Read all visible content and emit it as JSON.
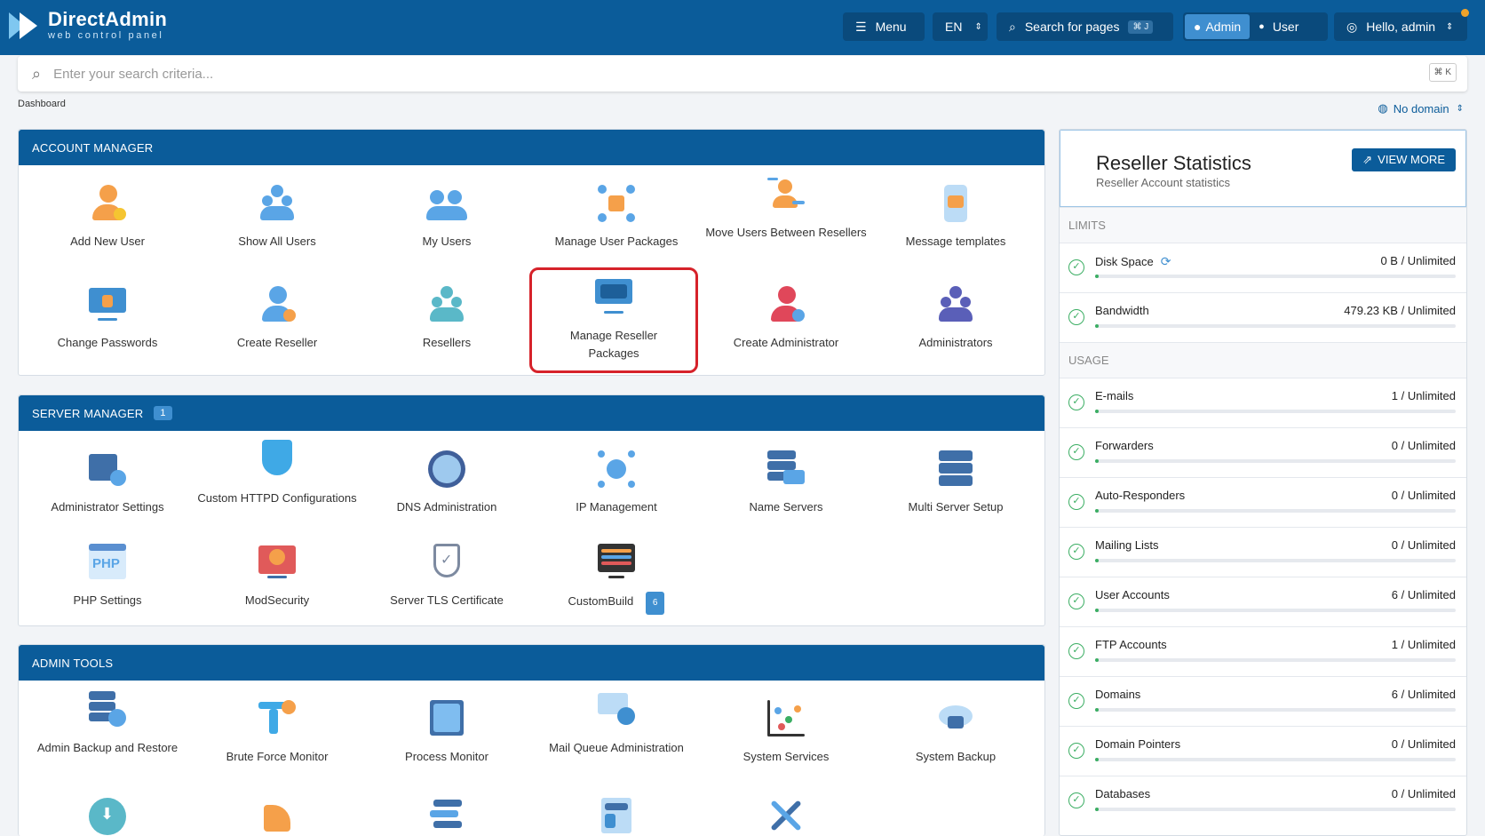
{
  "header": {
    "logo_title": "DirectAdmin",
    "logo_sub": "web control panel",
    "menu_label": "Menu",
    "lang": "EN",
    "search_pages": "Search for pages",
    "search_pages_kbd": "⌘ J",
    "role_admin": "Admin",
    "role_user": "User",
    "hello": "Hello, admin"
  },
  "search": {
    "placeholder": "Enter your search criteria...",
    "kbd": "⌘ K"
  },
  "breadcrumb": "Dashboard",
  "domain_selector": "No domain",
  "account_manager": {
    "title": "ACCOUNT MANAGER",
    "items": [
      "Add New User",
      "Show All Users",
      "My Users",
      "Manage User Packages",
      "Move Users Between Resellers",
      "Message templates",
      "Change Passwords",
      "Create Reseller",
      "Resellers",
      "Manage Reseller Packages",
      "Create Administrator",
      "Administrators"
    ]
  },
  "server_manager": {
    "title": "SERVER MANAGER",
    "badge": "1",
    "items": [
      "Administrator Settings",
      "Custom HTTPD Configurations",
      "DNS Administration",
      "IP Management",
      "Name Servers",
      "Multi Server Setup",
      "PHP Settings",
      "ModSecurity",
      "Server TLS Certificate",
      "CustomBuild"
    ],
    "custombuild_badge": "6"
  },
  "admin_tools": {
    "title": "ADMIN TOOLS",
    "items": [
      "Admin Backup and Restore",
      "Brute Force Monitor",
      "Process Monitor",
      "Mail Queue Administration",
      "System Services",
      "System Backup"
    ]
  },
  "stats": {
    "title": "Reseller Statistics",
    "subtitle": "Reseller Account statistics",
    "view_more": "VIEW MORE",
    "limits_title": "LIMITS",
    "usage_title": "USAGE",
    "limits": [
      {
        "name": "Disk Space",
        "value": "0 B / Unlimited"
      },
      {
        "name": "Bandwidth",
        "value": "479.23 KB / Unlimited"
      }
    ],
    "usage": [
      {
        "name": "E-mails",
        "value": "1 / Unlimited"
      },
      {
        "name": "Forwarders",
        "value": "0 / Unlimited"
      },
      {
        "name": "Auto-Responders",
        "value": "0 / Unlimited"
      },
      {
        "name": "Mailing Lists",
        "value": "0 / Unlimited"
      },
      {
        "name": "User Accounts",
        "value": "6 / Unlimited"
      },
      {
        "name": "FTP Accounts",
        "value": "1 / Unlimited"
      },
      {
        "name": "Domains",
        "value": "6 / Unlimited"
      },
      {
        "name": "Domain Pointers",
        "value": "0 / Unlimited"
      },
      {
        "name": "Databases",
        "value": "0 / Unlimited"
      }
    ]
  },
  "colors": {
    "brand": "#0b5c9a",
    "accent": "#3f8fd0",
    "ok": "#3bae63",
    "highlight": "#d6222a"
  }
}
